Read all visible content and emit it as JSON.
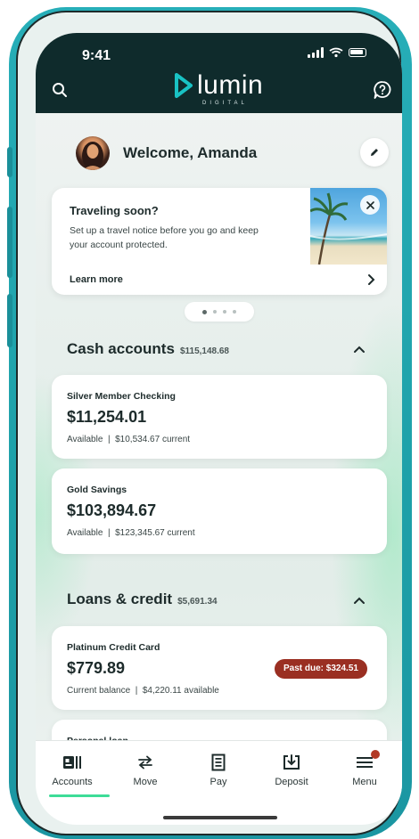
{
  "status_bar": {
    "time": "9:41"
  },
  "header": {
    "logo_text": "lumin",
    "logo_sub": "DIGITAL",
    "search_icon": "search-icon",
    "help_icon": "help-chat-icon"
  },
  "welcome": {
    "text": "Welcome, Amanda",
    "edit_icon": "pencil-icon"
  },
  "promo": {
    "title": "Traveling soon?",
    "body": "Set up a travel notice before you go and keep your account protected.",
    "link": "Learn more",
    "close_icon": "close-icon",
    "carousel": {
      "count": 4,
      "active_index": 0
    }
  },
  "cash_accounts": {
    "title": "Cash accounts",
    "total": "$115,148.68",
    "accounts": [
      {
        "name": "Silver Member Checking",
        "balance": "$11,254.01",
        "sub": "Available  |  $10,534.67 current"
      },
      {
        "name": "Gold Savings",
        "balance": "$103,894.67",
        "sub": "Available  |  $123,345.67 current"
      }
    ]
  },
  "loans": {
    "title": "Loans & credit",
    "total": "$5,691.34",
    "accounts": [
      {
        "name": "Platinum Credit Card",
        "balance": "$779.89",
        "sub": "Current balance  |  $4,220.11 available",
        "badge": "Past due: $324.51"
      },
      {
        "name": "Personal loan"
      }
    ]
  },
  "tabbar": {
    "tabs": [
      {
        "label": "Accounts",
        "icon": "accounts-icon"
      },
      {
        "label": "Move",
        "icon": "transfer-arrows-icon"
      },
      {
        "label": "Pay",
        "icon": "bill-icon"
      },
      {
        "label": "Deposit",
        "icon": "deposit-icon"
      },
      {
        "label": "Menu",
        "icon": "menu-icon"
      }
    ],
    "active": "Accounts"
  },
  "colors": {
    "header_bg": "#0f2b2c",
    "accent_green": "#3ddc97",
    "logo_accent": "#19c2c4",
    "past_due_bg": "#9a2f22",
    "frame": "#27aeb8"
  }
}
